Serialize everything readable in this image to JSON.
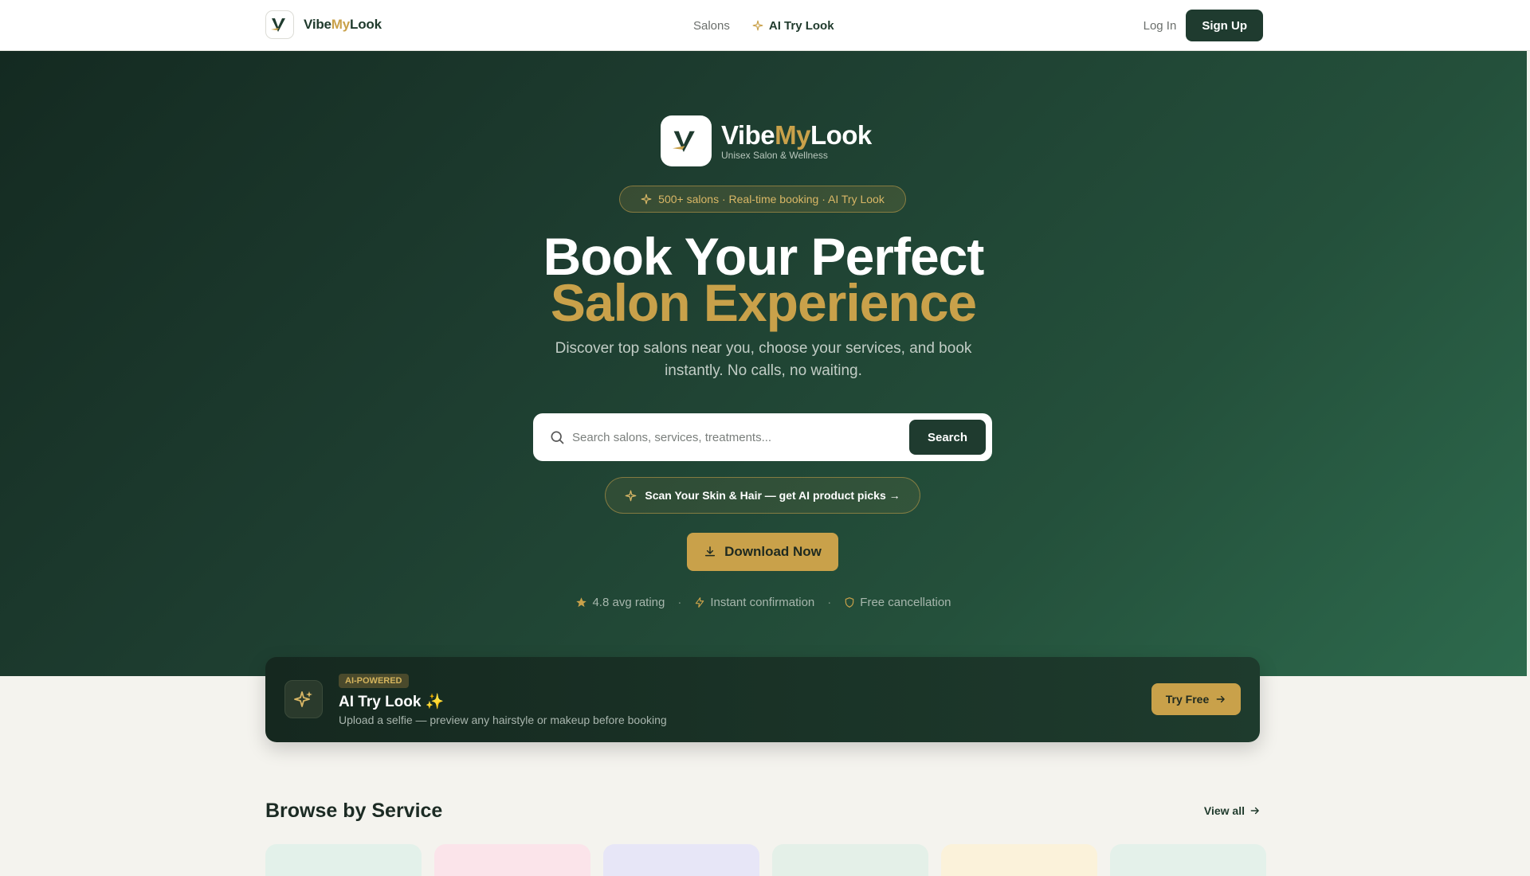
{
  "nav": {
    "brand": {
      "part1": "Vibe",
      "part2": "My",
      "part3": "Look"
    },
    "links": {
      "salons": "Salons",
      "ai_try_look": "AI Try Look"
    },
    "login": "Log In",
    "signup": "Sign Up"
  },
  "hero": {
    "brand": {
      "part1": "Vibe",
      "part2": "My",
      "part3": "Look"
    },
    "tagline": "Unisex Salon & Wellness",
    "pill": "500+ salons · Real-time booking · AI Try Look",
    "headline_line1": "Book Your Perfect",
    "headline_line2": "Salon Experience",
    "subtitle": "Discover top salons near you, choose your services, and book instantly. No calls, no waiting.",
    "search": {
      "placeholder": "Search salons, services, treatments...",
      "button": "Search"
    },
    "scan_cta": "Scan Your Skin & Hair — get AI product picks →",
    "download": "Download Now",
    "stats": {
      "rating": "4.8 avg rating",
      "confirmation": "Instant confirmation",
      "cancellation": "Free cancellation",
      "separator": "·"
    }
  },
  "ai_banner": {
    "badge": "AI-POWERED",
    "title": "AI Try Look ✨",
    "subtitle": "Upload a selfie — preview any hairstyle or makeup before booking",
    "button": "Try Free"
  },
  "browse": {
    "title": "Browse by Service",
    "view_all": "View all"
  },
  "colors": {
    "brand_green": "#1f3b2f",
    "accent_gold": "#c9a14a",
    "page_bg": "#f4f3ee",
    "service_cards": [
      "#e3f1ea",
      "#fbe4ea",
      "#e7e6f7",
      "#e4f0e8",
      "#fbf2da",
      "#e4f1ea"
    ]
  },
  "icons": {
    "brand_logo": "v-logo-icon",
    "nav_ai": "sparkle-icon",
    "search": "search-icon",
    "scan": "sparkle-icon",
    "download": "download-icon",
    "rating": "star-icon",
    "confirmation": "bolt-icon",
    "cancellation": "shield-icon",
    "banner": "sparkles-icon",
    "arrow": "arrow-right-icon"
  }
}
